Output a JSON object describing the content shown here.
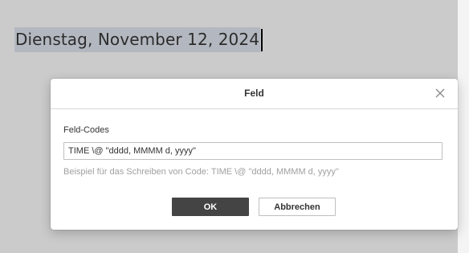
{
  "document": {
    "text": "Dienstag, November 12, 2024"
  },
  "dialog": {
    "title": "Feld",
    "close_icon": "close-icon",
    "field_label": "Feld-Codes",
    "field_value": "TIME \\@ \"dddd, MMMM d, yyyy\"",
    "hint": "Beispiel für das Schreiben von Code: TIME \\@ \"dddd, MMMM d, yyyy\"",
    "ok_label": "OK",
    "cancel_label": "Abbrechen"
  },
  "colors": {
    "canvas": "#cbcbcb",
    "selection": "#b3b8c0",
    "primary_button": "#444444"
  }
}
